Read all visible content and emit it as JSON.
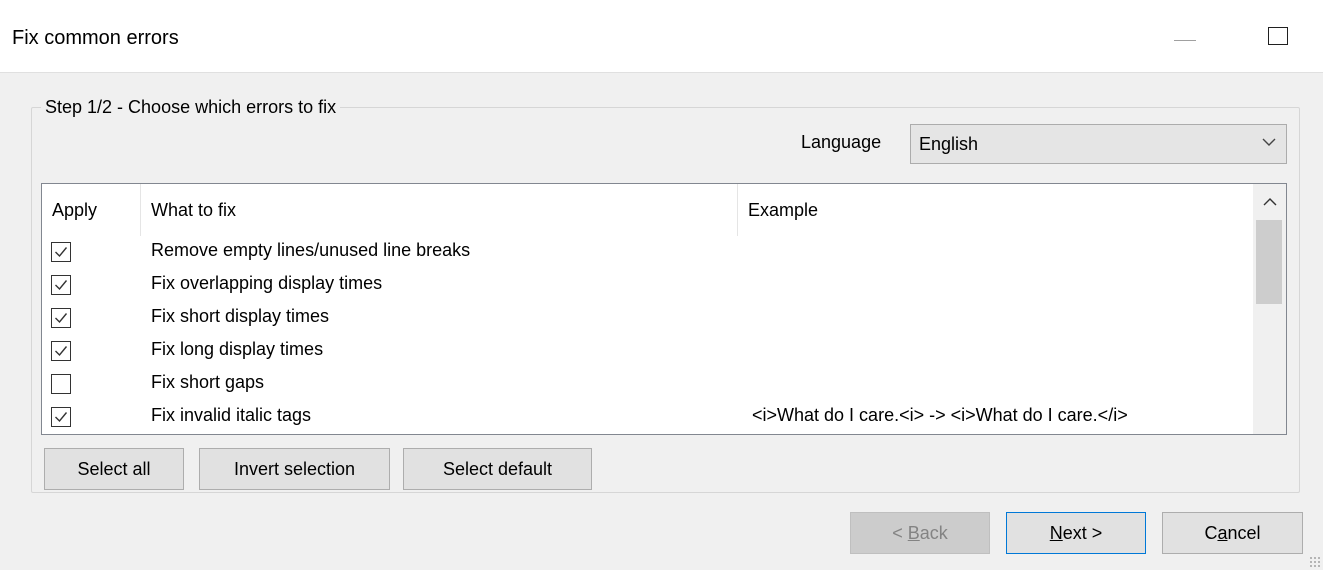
{
  "window": {
    "title": "Fix common errors"
  },
  "step": {
    "legend": "Step 1/2 - Choose which errors to fix",
    "language_label": "Language",
    "language_value": "English"
  },
  "list": {
    "columns": [
      "Apply",
      "What to fix",
      "Example"
    ],
    "rows": [
      {
        "checked": true,
        "what": "Remove empty lines/unused line breaks",
        "example": ""
      },
      {
        "checked": true,
        "what": "Fix overlapping display times",
        "example": ""
      },
      {
        "checked": true,
        "what": "Fix short display times",
        "example": ""
      },
      {
        "checked": true,
        "what": "Fix long display times",
        "example": ""
      },
      {
        "checked": false,
        "what": "Fix short gaps",
        "example": ""
      },
      {
        "checked": true,
        "what": "Fix invalid italic tags",
        "example": "<i>What do I care.<i> -> <i>What do I care.</i>"
      }
    ]
  },
  "buttons": {
    "select_all": "Select all",
    "invert_selection": "Invert selection",
    "select_default": "Select default",
    "back_prefix": "< ",
    "back_mnemonic": "B",
    "back_rest": "ack",
    "next_mnemonic": "N",
    "next_rest": "ext >",
    "cancel_pre": "C",
    "cancel_mnemonic": "a",
    "cancel_rest": "ncel"
  },
  "colors": {
    "accent": "#0078d7",
    "checkbox_border": "#333333",
    "list_border": "#828790"
  }
}
